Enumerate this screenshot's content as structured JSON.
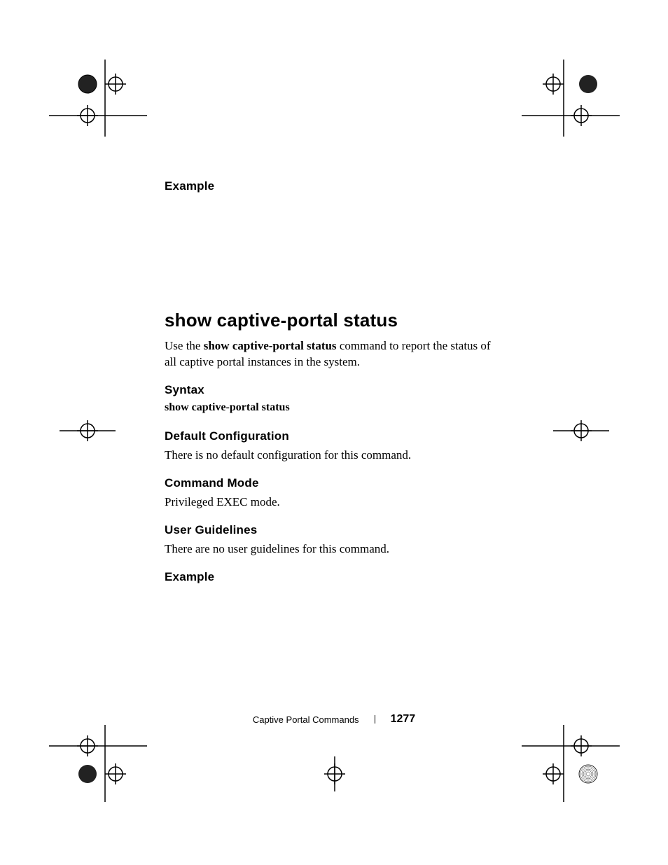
{
  "section_a": {
    "example_heading": "Example"
  },
  "command": {
    "title": "show captive-portal status",
    "intro_pre": "Use the ",
    "intro_cmd": "show captive-portal status",
    "intro_post": " command to report the status of all captive portal instances in the system."
  },
  "syntax": {
    "heading": "Syntax",
    "line": "show captive-portal status"
  },
  "default_config": {
    "heading": "Default Configuration",
    "text": "There is no default configuration for this command."
  },
  "command_mode": {
    "heading": "Command Mode",
    "text": "Privileged EXEC mode."
  },
  "user_guidelines": {
    "heading": "User Guidelines",
    "text": "There are no user guidelines for this command."
  },
  "section_b": {
    "example_heading": "Example"
  },
  "footer": {
    "chapter": "Captive Portal Commands",
    "page": "1277"
  }
}
